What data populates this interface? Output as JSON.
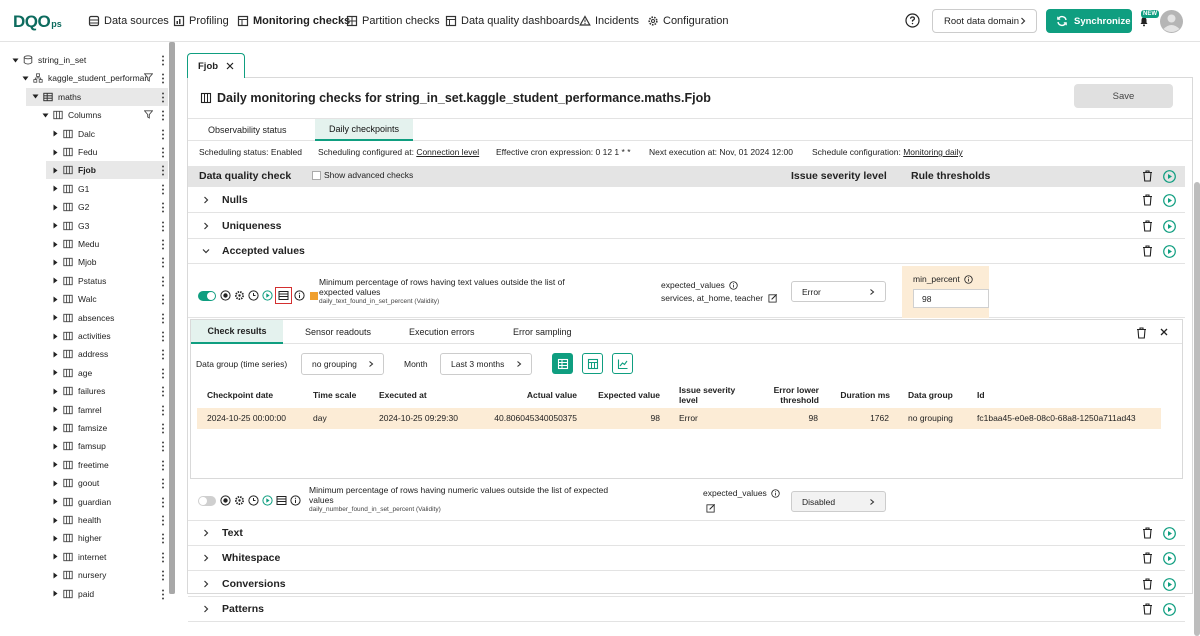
{
  "app": {
    "logo_main": "DQO",
    "logo_sub": "ps",
    "nav": [
      "Data sources",
      "Profiling",
      "Monitoring checks",
      "Partition checks",
      "Data quality dashboards",
      "Incidents",
      "Configuration"
    ],
    "domain_label": "Root data domain",
    "sync_label": "Synchronize",
    "new_badge": "NEW",
    "accent": "#0f9e80"
  },
  "sidebar": {
    "connection": "string_in_set",
    "schema_table": "kaggle_student_performar",
    "table": "maths",
    "columns_label": "Columns",
    "columns": [
      "Dalc",
      "Fedu",
      "Fjob",
      "G1",
      "G2",
      "G3",
      "Medu",
      "Mjob",
      "Pstatus",
      "Walc",
      "absences",
      "activities",
      "address",
      "age",
      "failures",
      "famrel",
      "famsize",
      "famsup",
      "freetime",
      "goout",
      "guardian",
      "health",
      "higher",
      "internet",
      "nursery",
      "paid"
    ],
    "selected": "Fjob"
  },
  "tab": {
    "label": "Fjob"
  },
  "panel": {
    "title": "Daily monitoring checks for string_in_set.kaggle_student_performance.maths.Fjob",
    "save_label": "Save",
    "subtabs": [
      "Observability status",
      "Daily checkpoints"
    ],
    "schedule": {
      "status": "Scheduling status: Enabled",
      "configured_prefix": "Scheduling configured at:",
      "configured_link": "Connection level",
      "cron": "Effective cron expression: 0 12 1 * *",
      "next": "Next execution at: Nov, 01 2024 12:00",
      "config_prefix": "Schedule configuration:",
      "config_link": "Monitoring daily"
    },
    "grid_header": {
      "check": "Data quality check",
      "advanced": "Show advanced checks",
      "severity": "Issue severity level",
      "thresholds": "Rule thresholds"
    },
    "groups": [
      "Nulls",
      "Uniqueness",
      "Accepted values",
      "Text",
      "Whitespace",
      "Conversions",
      "Patterns"
    ]
  },
  "check1": {
    "title": "Minimum percentage of rows having text values outside the list of expected values",
    "subtitle": "daily_text_found_in_set_percent (Validity)",
    "param_name": "expected_values",
    "param_value": "services, at_home, teacher",
    "severity": "Error",
    "threshold_label": "min_percent",
    "threshold_value": "98",
    "enabled": true
  },
  "results": {
    "tabs": [
      "Check results",
      "Sensor readouts",
      "Execution errors",
      "Error sampling"
    ],
    "data_group_label": "Data group (time series)",
    "data_group_value": "no grouping",
    "month_label": "Month",
    "month_value": "Last 3 months",
    "headers": [
      "Checkpoint date",
      "Time scale",
      "Executed at",
      "Actual value",
      "Expected value",
      "Issue severity level",
      "Error lower threshold",
      "Duration ms",
      "Data group",
      "Id"
    ],
    "rows": [
      [
        "2024-10-25 00:00:00",
        "day",
        "2024-10-25 09:29:30",
        "40.806045340050375",
        "98",
        "Error",
        "98",
        "1762",
        "no grouping",
        "fc1baa45-e0e8-08c0-68a8-1250a711ad43"
      ]
    ]
  },
  "check2": {
    "title": "Minimum percentage of rows having numeric values outside the list of expected values",
    "subtitle": "daily_number_found_in_set_percent (Validity)",
    "param_name": "expected_values",
    "severity": "Disabled",
    "enabled": false
  }
}
